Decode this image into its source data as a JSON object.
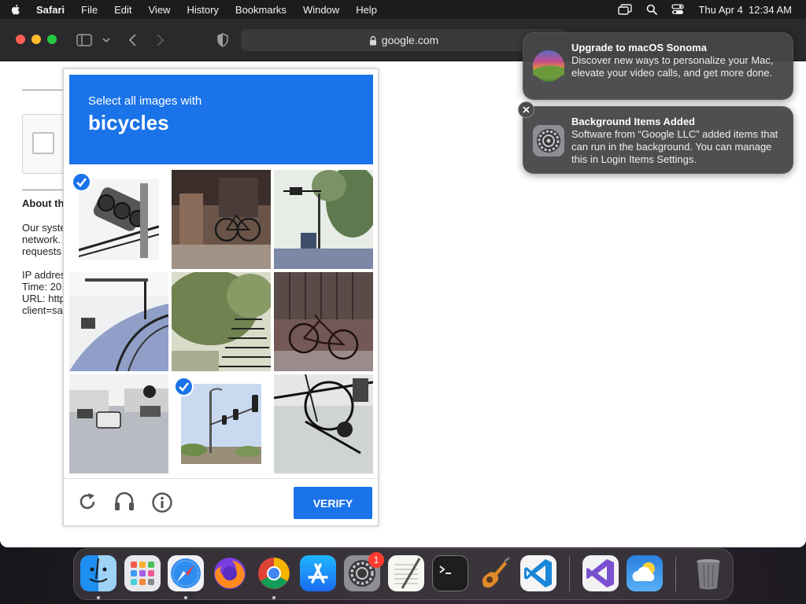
{
  "menubar": {
    "app_name": "Safari",
    "menus": [
      "File",
      "Edit",
      "View",
      "History",
      "Bookmarks",
      "Window",
      "Help"
    ],
    "clock": "Thu Apr 4  12:34 AM"
  },
  "browser": {
    "url": "google.com"
  },
  "page": {
    "about_heading": "About th",
    "paragraph_lines": [
      "Our syste",
      "network.",
      "requests"
    ],
    "info_lines": [
      "IP addres",
      "Time: 20",
      "URL: http",
      "client=sa"
    ]
  },
  "captcha": {
    "instruction_small": "Select all images with",
    "instruction_big": "bicycles",
    "verify_label": "VERIFY",
    "tiles": [
      {
        "subject": "traffic-light",
        "selected": true
      },
      {
        "subject": "bicycle-porch",
        "selected": false
      },
      {
        "subject": "street-trees",
        "selected": false
      },
      {
        "subject": "curved-road",
        "selected": false
      },
      {
        "subject": "stairs-trees",
        "selected": false
      },
      {
        "subject": "bicycle-sidewalk",
        "selected": false
      },
      {
        "subject": "street-cars",
        "selected": false
      },
      {
        "subject": "traffic-light-pole",
        "selected": true
      },
      {
        "subject": "bicycle-closeup",
        "selected": false
      }
    ]
  },
  "notifications": [
    {
      "title": "Upgrade to macOS Sonoma",
      "body": "Discover new ways to personalize your Mac, elevate your video calls, and get more done.",
      "icon": "macos-sonoma-icon"
    },
    {
      "title": "Background Items Added",
      "body": "Software from “Google LLC” added items that can run in the background. You can manage this in Login Items Settings.",
      "icon": "system-settings-icon"
    }
  ],
  "dock": {
    "apps": [
      "finder",
      "launchpad",
      "safari",
      "firefox",
      "chrome",
      "app-store",
      "system-settings",
      "textedit",
      "terminal",
      "garageband",
      "vscode",
      "visual-studio",
      "weather",
      "trash"
    ],
    "settings_badge": "1"
  },
  "colors": {
    "captcha_blue": "#1a73e8",
    "menubar": "#1c1c1e",
    "notification_bg": "#464648"
  }
}
